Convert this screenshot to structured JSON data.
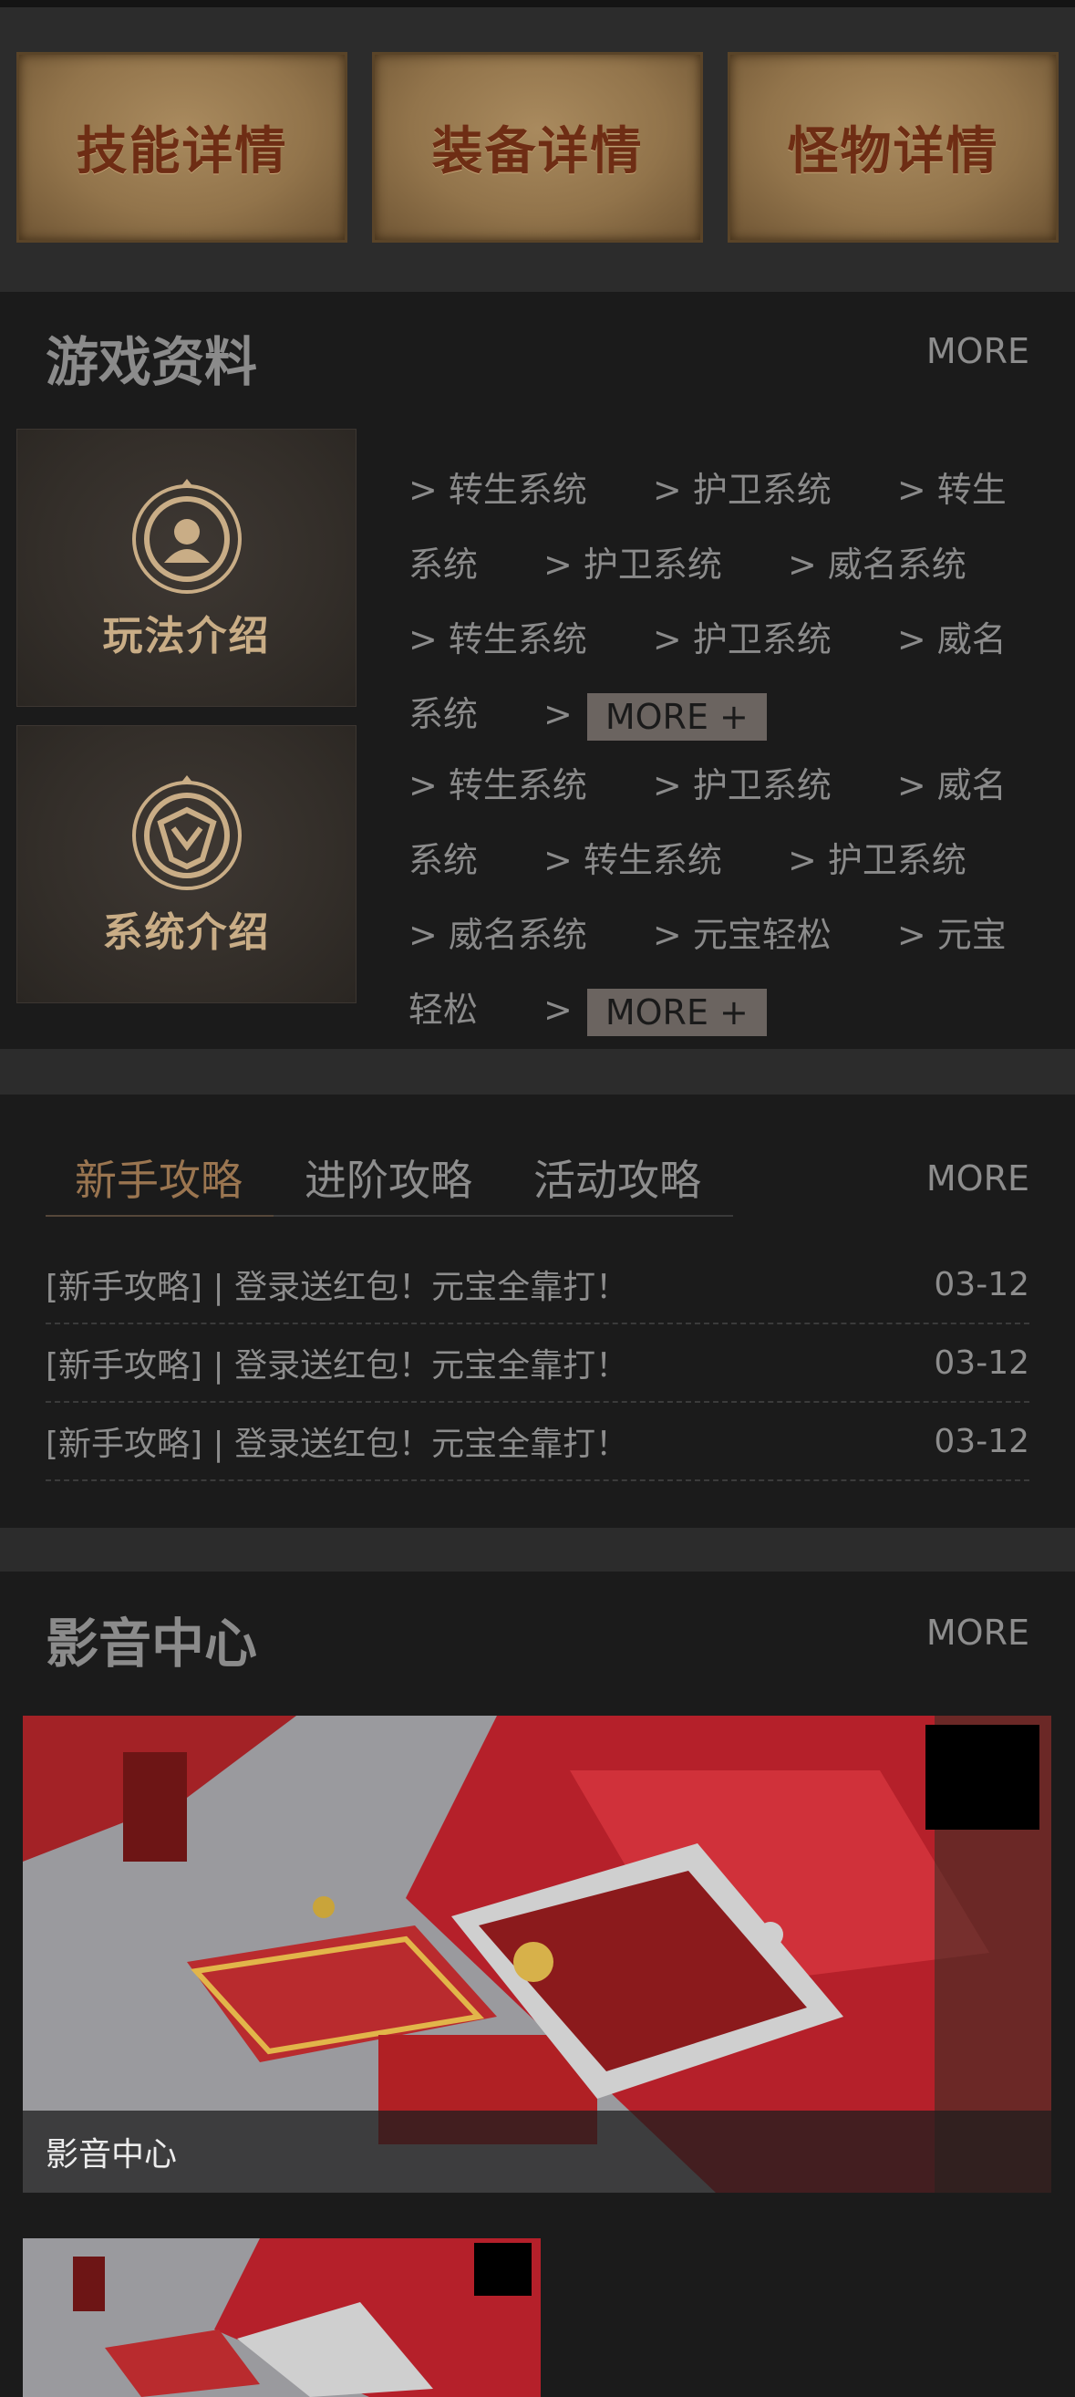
{
  "top_buttons": [
    "技能详情",
    "装备详情",
    "怪物详情"
  ],
  "game_data": {
    "title": "游戏资料",
    "more": "MORE",
    "cards": [
      {
        "label": "玩法介绍",
        "icon": "gameplay-emblem-icon"
      },
      {
        "label": "系统介绍",
        "icon": "system-emblem-icon"
      }
    ],
    "link_groups": [
      {
        "links": [
          "> 转生系统",
          "> 护卫系统",
          "> 转生系统",
          "> 护卫系统",
          "> 威名系统",
          "> 转生系统",
          "> 护卫系统",
          "> 威名系统"
        ],
        "more_label": "MORE +"
      },
      {
        "links": [
          "> 转生系统",
          "> 护卫系统",
          "> 威名系统",
          "> 转生系统",
          "> 护卫系统",
          "> 威名系统",
          "> 元宝轻松",
          "> 元宝轻松"
        ],
        "more_label": "MORE +"
      }
    ]
  },
  "guides": {
    "tabs": [
      "新手攻略",
      "进阶攻略",
      "活动攻略"
    ],
    "active_tab": 0,
    "more": "MORE",
    "rows": [
      {
        "title": "[新手攻略] | 登录送红包！元宝全靠打！",
        "date": "03-12"
      },
      {
        "title": "[新手攻略] | 登录送红包！元宝全靠打！",
        "date": "03-12"
      },
      {
        "title": "[新手攻略] | 登录送红包！元宝全靠打！",
        "date": "03-12"
      }
    ]
  },
  "media": {
    "title": "影音中心",
    "more": "MORE",
    "featured_caption": "影音中心"
  },
  "colors": {
    "background": "#1b1b1b",
    "band": "#2c2c2c",
    "active_tab": "#9a7550",
    "card_label": "#c9ad86"
  }
}
